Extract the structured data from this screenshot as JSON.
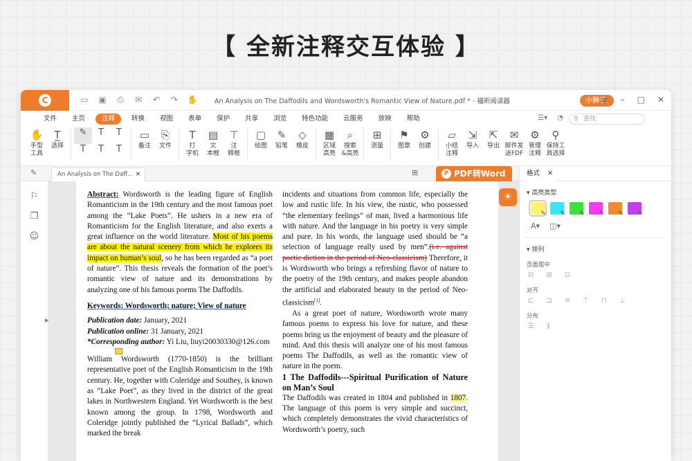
{
  "banner": "【 全新注释交互体验 】",
  "window": {
    "title": "An Analysis on The Daffodils and Wordsworth's Romantic View of Nature.pdf * - 福昕阅读器",
    "user": "小狮子.",
    "search_placeholder": "查找"
  },
  "menu": [
    "文件",
    "主页",
    "注释",
    "转换",
    "视图",
    "表单",
    "保护",
    "共享",
    "浏览",
    "特色功能",
    "云服务",
    "放映",
    "帮助"
  ],
  "menu_active_index": 2,
  "ribbon": {
    "hand": "手型\n工具",
    "select": "选择",
    "note": "备注",
    "file": "文件",
    "typewriter": "打\n字机",
    "textbox": "文\n本框",
    "callout": "注\n释框",
    "draw": "绘图",
    "pencil": "铅笔",
    "eraser": "橡皮",
    "area_highlight": "区域\n高亮",
    "search_highlight": "搜索\n&高亮",
    "measure": "测量",
    "stamp": "图章",
    "create": "创建",
    "summary": "小结\n注释",
    "import": "导入",
    "export": "导出",
    "email_fdf": "邮件发\n送FDF",
    "manage": "管理\n注释",
    "keep_tool": "保持工\n具选择"
  },
  "doc_tab": "An Analysis on The Daff...",
  "pdf2word": "PDF转Word",
  "document": {
    "abstract_label": "Abstract:",
    "abstract_1": " Wordsworth is the leading figure of English Romanticism in the 19th century and the most famous poet among the “Lake Poets”. He ushers in a new era of Romanticism for the English literature, and also exerts a great influence on the world literature. ",
    "abstract_hl": "Most of his poems are about the natural scenery from which he explores its impact on human’s soul",
    "abstract_2": ", so he has been regarded as “a poet of nature”. This thesis reveals the formation of the poet’s romantic view of nature and its demonstrations by analyzing one of his famous poems The Daffodils.",
    "keywords": "Keywords: Wordsworth; nature; View of nature",
    "pub_date_label": "Publication date:",
    "pub_date": " January, 2021",
    "pub_online_label": "Publication online:",
    "pub_online": " 31 January, 2021",
    "corr_label": "*Corresponding author:",
    "corr": " Yi Liu, liuyi20030330@126.com",
    "body_1": "William Wordsworth (1770-1850) is the brilliant representative poet of the English Romanticism in the 19th century. He, together with Coleridge and Southey, is known as “Lake Poet”, as they lived in the district of the great lakes in Northwestern England. Yet Wordsworth is the best known among the group. In 1798, Wordsworth and Coleridge jointly published the “Lyrical Ballads”, which marked the break",
    "right_1a": "incidents and situations from common life, especially the low and rustic life. In his view, the rustic, who possessed “the elementary feelings” of man, lived a harmonious life with nature. And the language in his poetry is very simple and pure. In his words, the language used should be “a selection of language really used by men”.",
    "right_strike": "(i.e. against poetic diction in the period of Neo-classicism)",
    "right_1b": " Therefore, it is Wordsworth who brings a refreshing flavor of nature to the poetry of the 19th century, and makes people abandon the artificial and elaborated beauty in the period of Neo-classicism",
    "right_ref": "[1]",
    "right_1c": ".",
    "right_2": "As a great poet of nature, Wordsworth wrote many famous poems to express his love for nature, and these poems bring us the enjoyment of beauty and the pleasure of mind. And this thesis will analyze one of his most famous poems The Daffodils, as well as the romantic view of nature in the poem.",
    "section_title": "1  The Daffodils---Spiritual Purification of Nature on Man’s Soul",
    "right_3a": "The Daffodils was created in 1804 and published in ",
    "right_3_hl": "1807",
    "right_3b": ". The language of this poem is very simple and succinct, which completely demonstrates the vivid characteristics of Wordsworth’s poetry, such"
  },
  "panel": {
    "tab": "格式",
    "highlight_type": "高亮类型",
    "arrange": "排列",
    "page_center": "页面居中",
    "align": "对齐",
    "distribute": "分布",
    "swatch_colors": [
      "#fff36a",
      "#39e6f3",
      "#3de03d",
      "#f23ef0",
      "#f08a2a",
      "#c23ef0"
    ]
  }
}
